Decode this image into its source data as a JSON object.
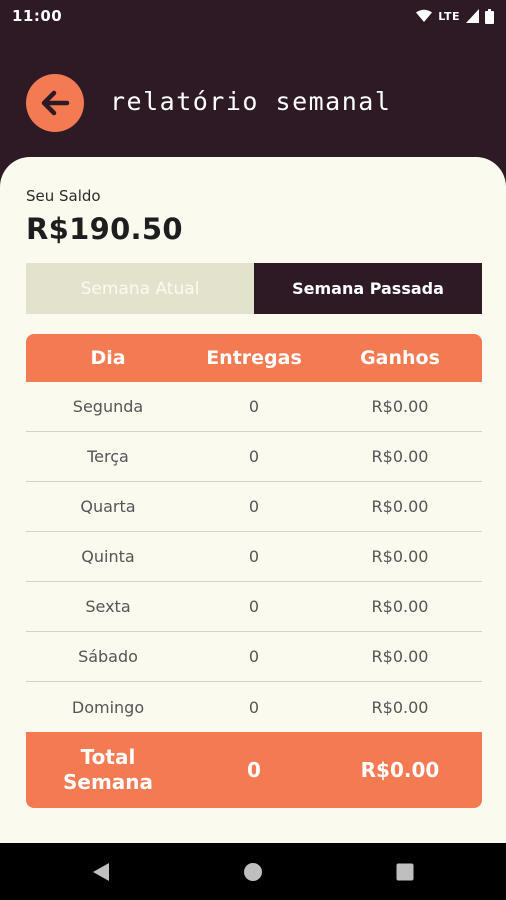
{
  "status_bar": {
    "time": "11:00",
    "network": "LTE",
    "icons": [
      "wifi-icon",
      "signal-icon",
      "battery-icon"
    ]
  },
  "header": {
    "title": "relatório semanal",
    "back_icon": "arrow-left-icon"
  },
  "balance": {
    "label": "Seu Saldo",
    "value": "R$190.50"
  },
  "tabs": [
    {
      "label": "Semana Atual",
      "selected": false
    },
    {
      "label": "Semana Passada",
      "selected": true
    }
  ],
  "table": {
    "headers": [
      "Dia",
      "Entregas",
      "Ganhos"
    ],
    "rows": [
      {
        "day": "Segunda",
        "deliveries": "0",
        "earnings": "R$0.00"
      },
      {
        "day": "Terça",
        "deliveries": "0",
        "earnings": "R$0.00"
      },
      {
        "day": "Quarta",
        "deliveries": "0",
        "earnings": "R$0.00"
      },
      {
        "day": "Quinta",
        "deliveries": "0",
        "earnings": "R$0.00"
      },
      {
        "day": "Sexta",
        "deliveries": "0",
        "earnings": "R$0.00"
      },
      {
        "day": "Sábado",
        "deliveries": "0",
        "earnings": "R$0.00"
      },
      {
        "day": "Domingo",
        "deliveries": "0",
        "earnings": "R$0.00"
      }
    ],
    "total": {
      "label_line1": "Total",
      "label_line2": "Semana",
      "deliveries": "0",
      "earnings": "R$0.00"
    }
  },
  "nav": {
    "buttons": [
      "back-triangle-icon",
      "home-circle-icon",
      "recents-square-icon"
    ]
  },
  "colors": {
    "dark": "#2e1a24",
    "accent": "#f47a52",
    "background": "#fbfaef",
    "tab_inactive": "#e3e3cd"
  }
}
